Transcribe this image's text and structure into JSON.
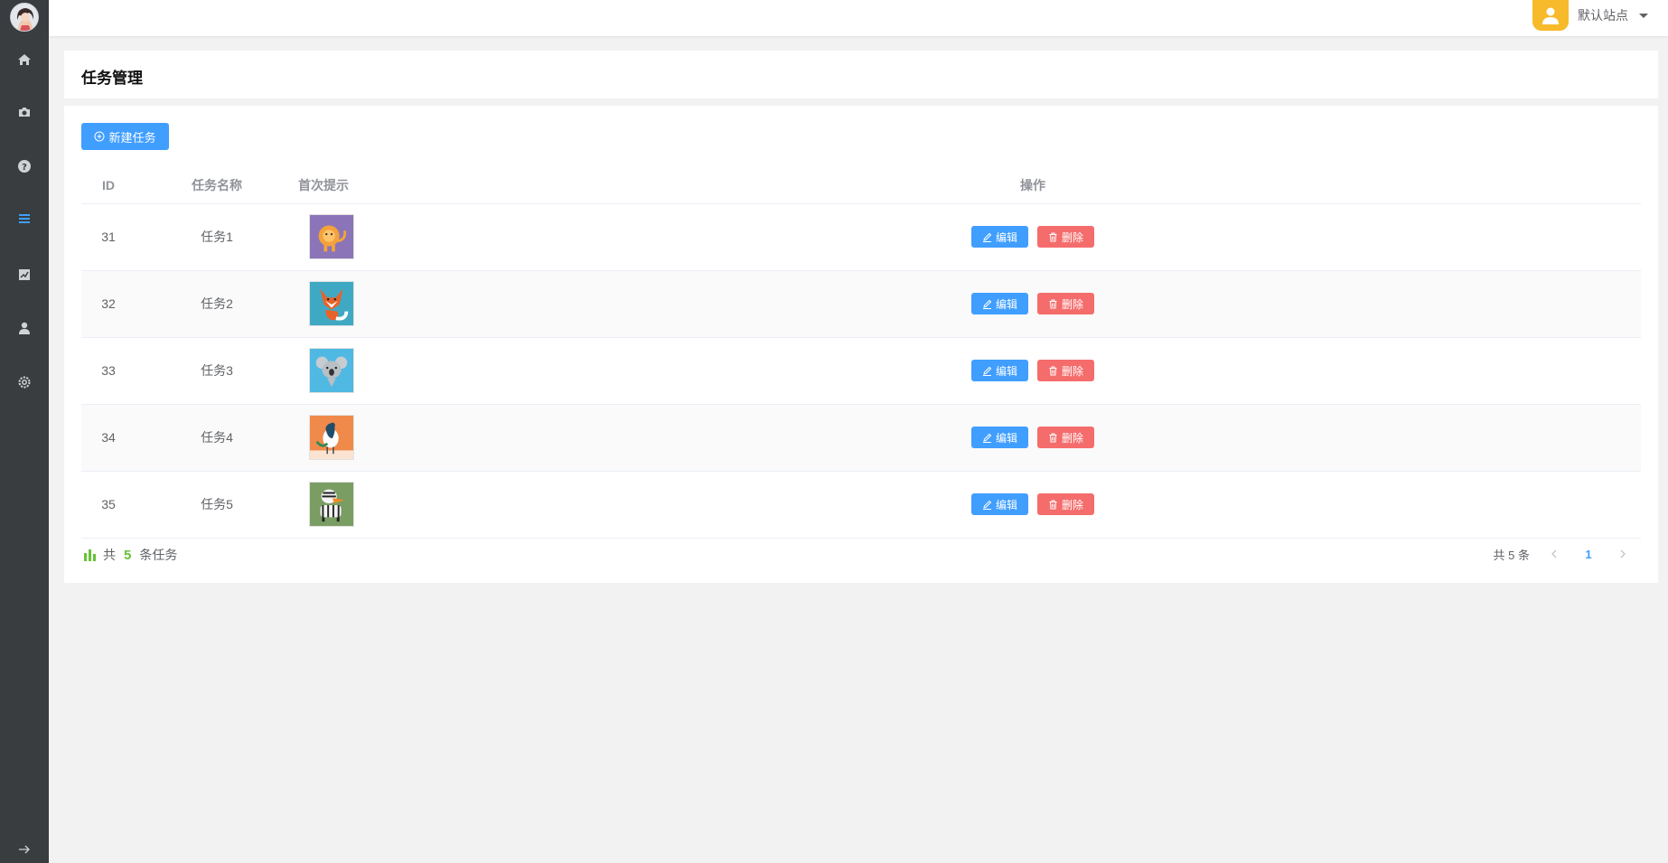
{
  "header": {
    "site_name": "默认站点"
  },
  "sidebar": {
    "items": [
      {
        "icon": "home-icon"
      },
      {
        "icon": "camera-icon"
      },
      {
        "icon": "help-icon"
      },
      {
        "icon": "list-icon",
        "active": true
      },
      {
        "icon": "chart-icon"
      },
      {
        "icon": "user-icon"
      },
      {
        "icon": "settings-icon"
      }
    ],
    "toggle_icon": "arrow-right-icon"
  },
  "page": {
    "title": "任务管理",
    "new_button": "新建任务"
  },
  "table": {
    "columns": [
      "ID",
      "任务名称",
      "首次提示",
      "操作"
    ],
    "rows": [
      {
        "id": "31",
        "name": "任务1",
        "image": "lion"
      },
      {
        "id": "32",
        "name": "任务2",
        "image": "fox"
      },
      {
        "id": "33",
        "name": "任务3",
        "image": "koala"
      },
      {
        "id": "34",
        "name": "任务4",
        "image": "peacock"
      },
      {
        "id": "35",
        "name": "任务5",
        "image": "zebra"
      }
    ],
    "edit_label": "编辑",
    "delete_label": "删除"
  },
  "footer": {
    "prefix": "共",
    "count": "5",
    "suffix": "条任务"
  },
  "pagination": {
    "total": "共 5 条",
    "current_page": "1"
  },
  "colors": {
    "primary": "#409eff",
    "danger": "#f56c6c",
    "success": "#67c23a",
    "sidebar": "#393d3f"
  }
}
